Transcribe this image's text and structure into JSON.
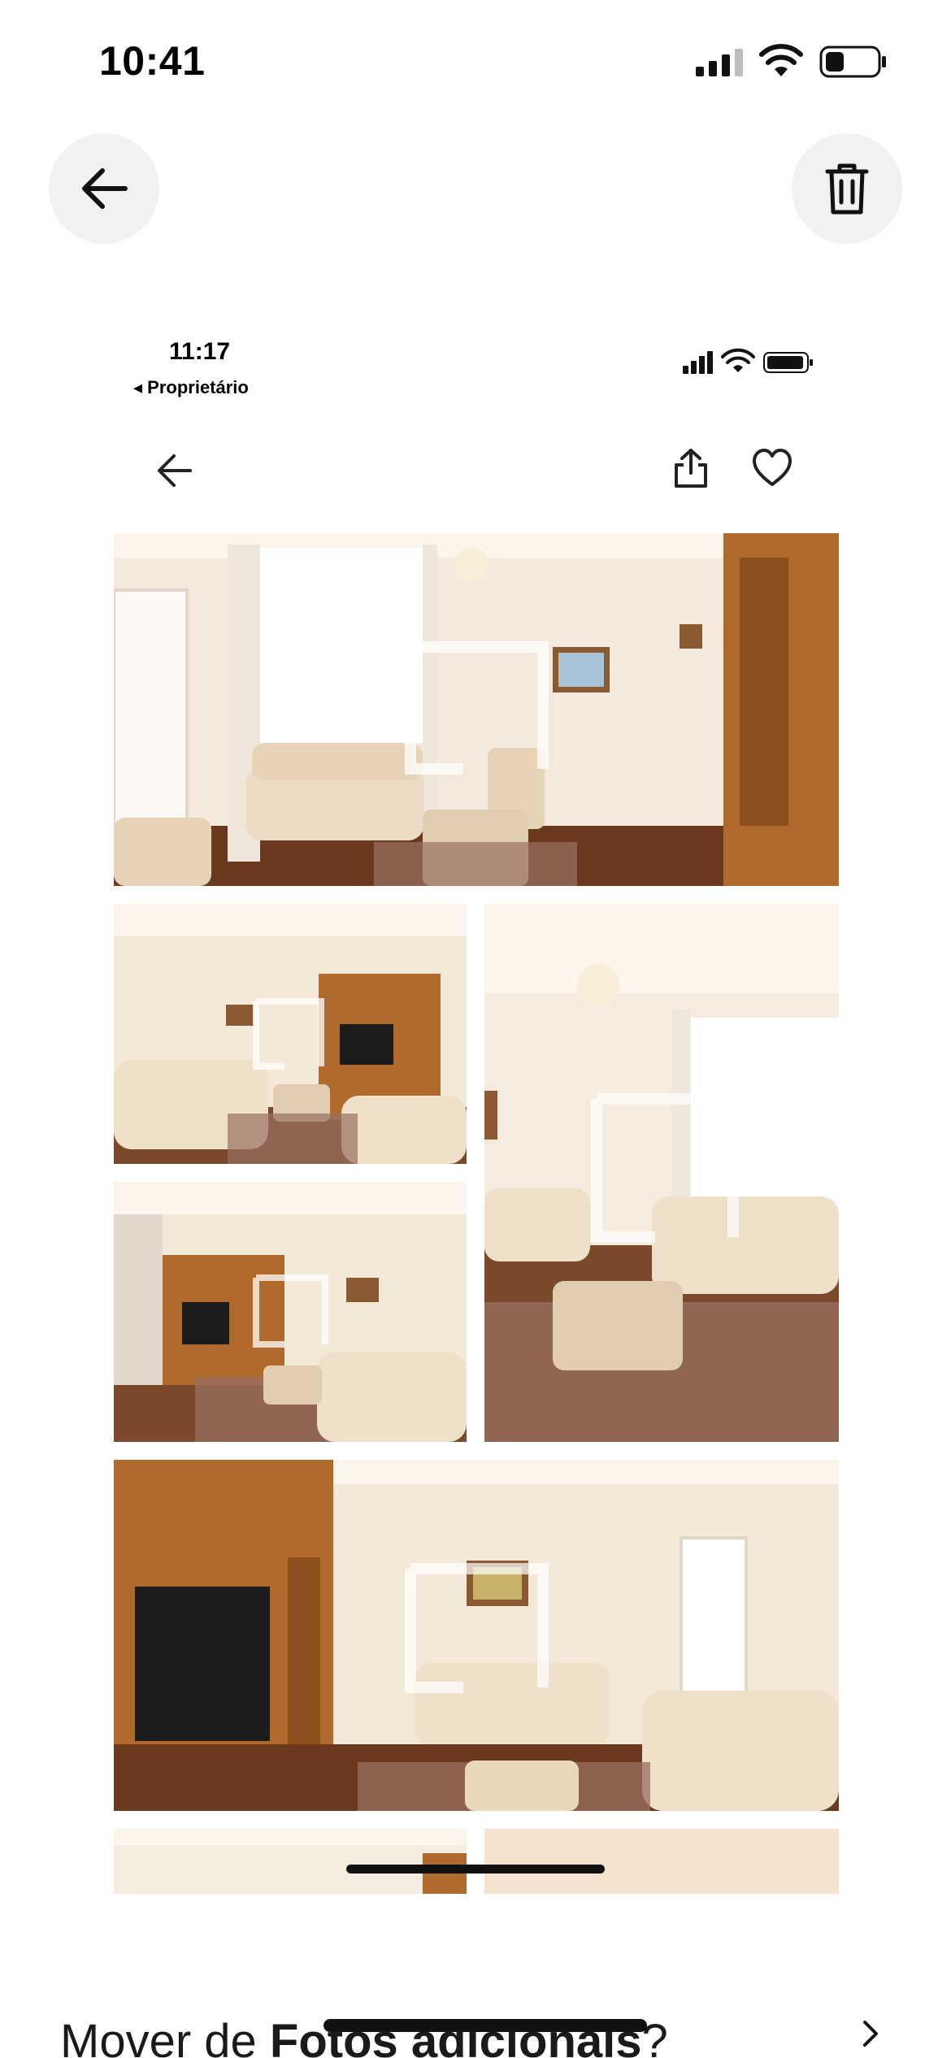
{
  "status_bar": {
    "time": "10:41",
    "icons": [
      "cellular-signal-icon",
      "wifi-icon",
      "battery-icon"
    ]
  },
  "toolbar": {
    "back_icon": "arrow-left-icon",
    "trash_icon": "trash-icon"
  },
  "inner_screenshot": {
    "status_time": "11:17",
    "back_to_app": "◂ Proprietário",
    "icons": [
      "arrow-left-icon",
      "share-icon",
      "heart-icon",
      "cellular-signal-icon",
      "wifi-icon",
      "battery-icon"
    ],
    "photos": [
      "living-room-photo",
      "living-room-photo",
      "living-room-photo",
      "living-room-photo",
      "living-room-photo",
      "living-room-photo",
      "living-room-photo"
    ]
  },
  "bottom": {
    "prompt_prefix": "Mover de ",
    "prompt_album": "Fotos adicionais",
    "prompt_suffix": "?",
    "chevron_icon": "chevron-right-icon"
  },
  "colors": {
    "button_bg": "#f1f1f1",
    "wall": "#f3e6d6",
    "wood": "#b06a2c",
    "sofa": "#ecdcc4",
    "rug": "#9a6f63"
  }
}
